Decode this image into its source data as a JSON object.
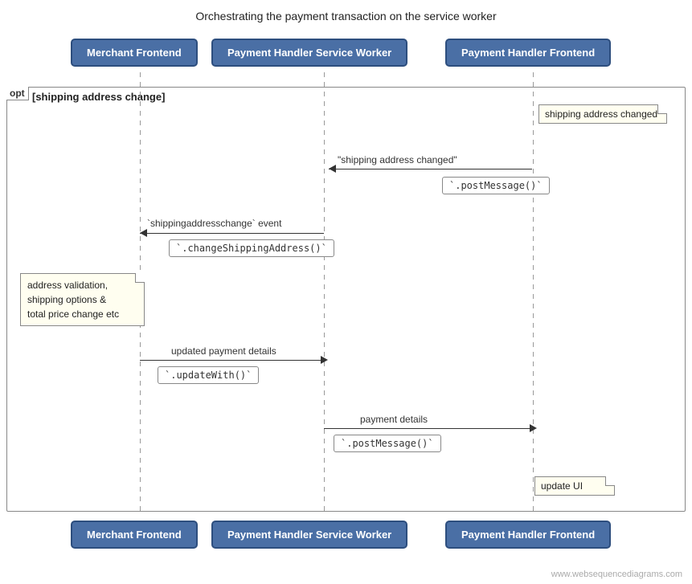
{
  "title": "Orchestrating the payment transaction on the service worker",
  "actors": {
    "merchant": "Merchant Frontend",
    "payment_handler": "Payment Handler Service Worker",
    "payment_frontend": "Payment Handler Frontend"
  },
  "opt": {
    "label": "opt",
    "condition": "[shipping address change]"
  },
  "notes": {
    "shipping_changed": "shipping address changed",
    "address_validation": "address validation,\nshipping options &\ntotal price change etc",
    "update_ui": "update UI"
  },
  "arrows": [
    {
      "label": "\"shipping address changed\"",
      "direction": "left"
    },
    {
      "label": "`shippingaddresschange` event",
      "direction": "left"
    },
    {
      "label": "updated payment details",
      "direction": "right"
    },
    {
      "label": "payment details",
      "direction": "right"
    }
  ],
  "code_boxes": [
    "`.postMessage()`",
    "`.changeShippingAddress()`",
    "`.updateWith()`",
    "`.postMessage()`"
  ],
  "watermark": "www.websequencediagrams.com"
}
